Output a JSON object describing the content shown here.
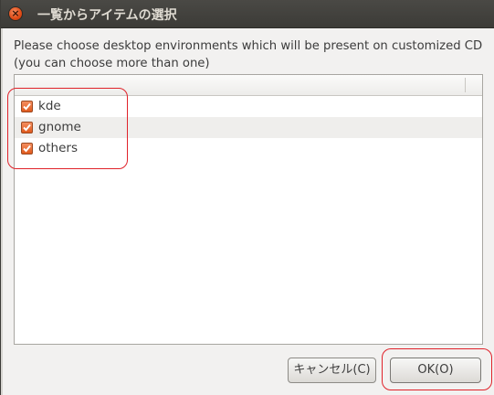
{
  "window": {
    "title": "一覧からアイテムの選択",
    "close_glyph": "×"
  },
  "prompt": {
    "line1": "Please choose desktop environments which will be present on customized CD",
    "line2": "(you can choose more than one)"
  },
  "list": {
    "items": [
      {
        "label": "kde",
        "checked": true
      },
      {
        "label": "gnome",
        "checked": true
      },
      {
        "label": "others",
        "checked": true
      }
    ]
  },
  "buttons": {
    "cancel_label": "キャンセル(C)",
    "ok_label": "OK(O)"
  },
  "colors": {
    "accent_checkbox": "#e05a1d",
    "highlight_annotation": "#e0222a",
    "titlebar": "#3c3b37"
  }
}
